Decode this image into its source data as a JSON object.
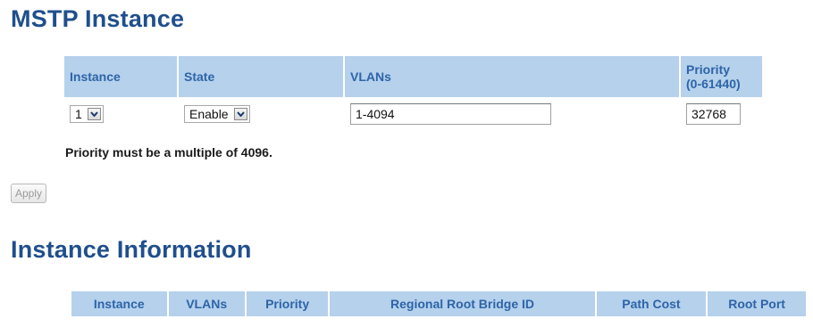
{
  "mstp_section": {
    "title": "MSTP Instance",
    "columns": {
      "instance": "Instance",
      "state": "State",
      "vlans": "VLANs",
      "priority_line1": "Priority",
      "priority_line2": "(0-61440)"
    },
    "row": {
      "instance": "1",
      "state": "Enable",
      "vlans": "1-4094",
      "priority": "32768"
    },
    "note": "Priority must be a multiple of 4096.",
    "apply_label": "Apply"
  },
  "info_section": {
    "title": "Instance Information",
    "columns": [
      "Instance",
      "VLANs",
      "Priority",
      "Regional Root Bridge ID",
      "Path Cost",
      "Root Port"
    ]
  },
  "colors": {
    "title": "#1f4f8c",
    "header_bg": "#b5d1ec",
    "header_text": "#2e64a8"
  },
  "icons": {
    "select_arrow": "chevron-down-icon"
  }
}
